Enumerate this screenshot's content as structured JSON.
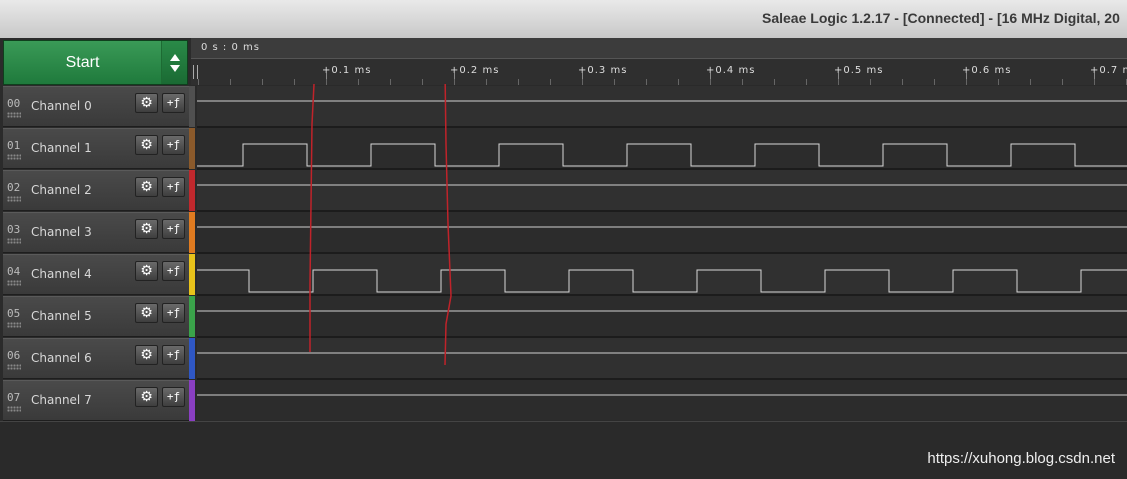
{
  "window": {
    "title": "Saleae Logic 1.2.17 - [Connected] - [16 MHz Digital, 20"
  },
  "controls": {
    "start_label": "Start"
  },
  "timeline": {
    "origin_label": "0 s : 0 ms",
    "ticks": [
      "+0.1 ms",
      "+0.2 ms",
      "+0.3 ms",
      "+0.4 ms",
      "+0.5 ms",
      "+0.6 ms",
      "+0.7 m"
    ]
  },
  "channels": [
    {
      "num": "00",
      "name": "Channel 0",
      "color": "#505050"
    },
    {
      "num": "01",
      "name": "Channel 1",
      "color": "#8b5a2b"
    },
    {
      "num": "02",
      "name": "Channel 2",
      "color": "#c0282d"
    },
    {
      "num": "03",
      "name": "Channel 3",
      "color": "#e07b20"
    },
    {
      "num": "04",
      "name": "Channel 4",
      "color": "#e8c21a"
    },
    {
      "num": "05",
      "name": "Channel 5",
      "color": "#3aa34a"
    },
    {
      "num": "06",
      "name": "Channel 6",
      "color": "#2f57c4"
    },
    {
      "num": "07",
      "name": "Channel 7",
      "color": "#8a3fc2"
    }
  ],
  "icons": {
    "settings": "gear-icon",
    "trigger": "trigger-icon",
    "expand": "up-down-arrows-icon"
  },
  "watermark": "https://xuhong.blog.csdn.net"
}
